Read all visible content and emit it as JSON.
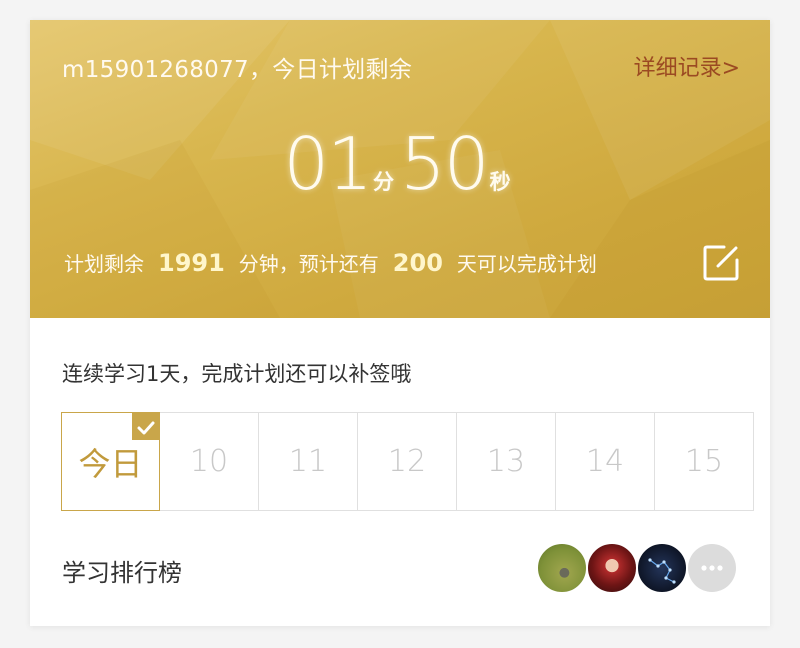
{
  "header": {
    "account_line": "m15901268077，今日计划剩余",
    "detail_link": "详细记录>"
  },
  "timer": {
    "minutes": "01",
    "minutes_unit": "分",
    "seconds": "50",
    "seconds_unit": "秒"
  },
  "plan": {
    "prefix": "计划剩余",
    "remaining_minutes": "1991",
    "middle": "分钟，预计还有",
    "remaining_days": "200",
    "suffix": "天可以完成计划"
  },
  "streak": {
    "text": "连续学习1天，完成计划还可以补签哦"
  },
  "days": [
    {
      "label": "今日",
      "checked": true
    },
    {
      "label": "10",
      "checked": false
    },
    {
      "label": "11",
      "checked": false
    },
    {
      "label": "12",
      "checked": false
    },
    {
      "label": "13",
      "checked": false
    },
    {
      "label": "14",
      "checked": false
    },
    {
      "label": "15",
      "checked": false
    }
  ],
  "ranking": {
    "label": "学习排行榜",
    "avatars": [
      "avatar-grass",
      "avatar-opera",
      "avatar-constellation"
    ],
    "more_icon": "more-icon"
  },
  "colors": {
    "gold_accent": "#c9a64a",
    "link_brown": "#9b4a22"
  }
}
